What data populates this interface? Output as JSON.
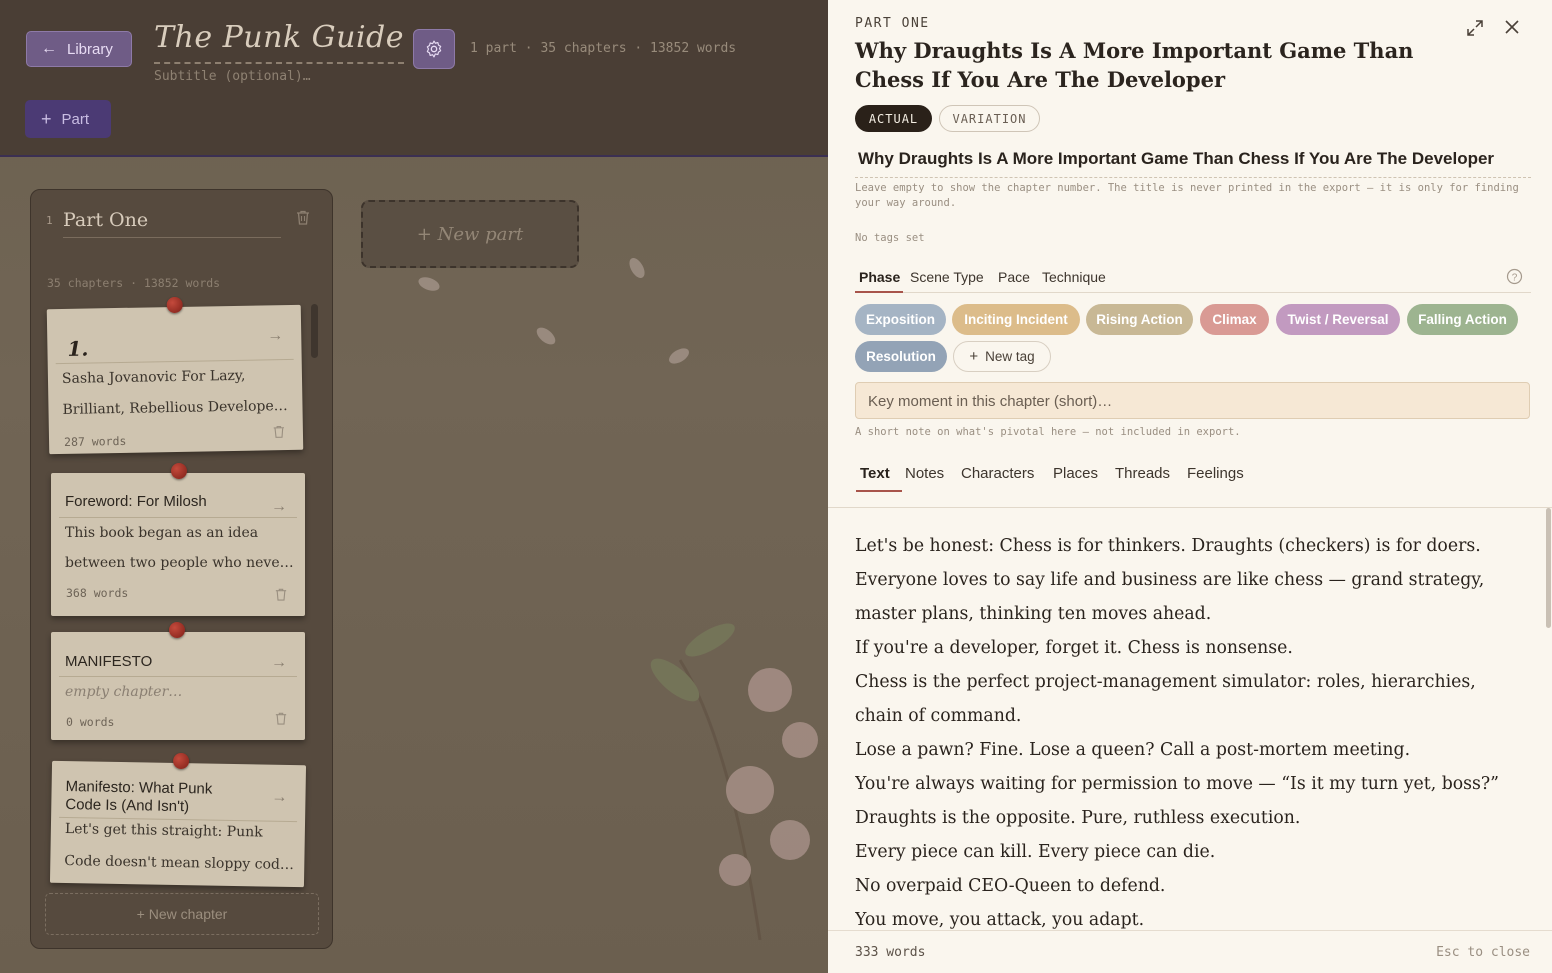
{
  "header": {
    "library_label": "Library",
    "book_title": "The Punk Guideto",
    "subtitle_placeholder": "Subtitle (optional)…",
    "stats": "1 part · 35 chapters · 13852 words",
    "add_part_label": "Part"
  },
  "board": {
    "part": {
      "number": "1",
      "name": "Part One",
      "stats": "35 chapters · 13852 words"
    },
    "cards": [
      {
        "title": "1.",
        "line1": "Sasha Jovanovic For Lazy,",
        "line2": "Brilliant, Rebellious Develope…",
        "words": "287 words"
      },
      {
        "title": "Foreword: For Milosh",
        "line1": "This book began as an idea",
        "line2": "between two people who neve…",
        "words": "368 words"
      },
      {
        "title": "MANIFESTO",
        "line1": "empty chapter…",
        "words": "0 words"
      },
      {
        "title_line1": "Manifesto: What Punk",
        "title_line2": "Code Is (And Isn't)",
        "line1": "Let's get this straight: Punk",
        "line2": "Code doesn't mean sloppy cod…"
      }
    ],
    "new_chapter_label": "+ New chapter",
    "new_part_label": "+ New part"
  },
  "panel": {
    "kicker": "PART ONE",
    "title": "Why Draughts Is A More Important Game Than Chess If You Are The Developer",
    "mode_actual": "ACTUAL",
    "mode_variation": "VARIATION",
    "title_input_value": "Why Draughts Is A More Important Game Than Chess If You Are The Developer",
    "title_hint": "Leave empty to show the chapter number. The title is never printed in the export — it is only for finding your way around.",
    "tags_status": "No tags set",
    "tag_tabs": [
      "Phase",
      "Scene Type",
      "Pace",
      "Technique"
    ],
    "tags": [
      {
        "label": "Exposition",
        "color": "#a5b4c4"
      },
      {
        "label": "Inciting Incident",
        "color": "#dcbc8a"
      },
      {
        "label": "Rising Action",
        "color": "#c8b895"
      },
      {
        "label": "Climax",
        "color": "#d99a94"
      },
      {
        "label": "Twist / Reversal",
        "color": "#c29ac0"
      },
      {
        "label": "Falling Action",
        "color": "#9db490"
      },
      {
        "label": "Resolution",
        "color": "#93a3b6"
      }
    ],
    "new_tag_label": "New tag",
    "moment_placeholder": "Key moment in this chapter (short)…",
    "moment_hint": "A short note on what's pivotal here — not included in export.",
    "content_tabs": [
      "Text",
      "Notes",
      "Characters",
      "Places",
      "Threads",
      "Feelings"
    ],
    "paragraphs": [
      "Let's be honest: Chess is for thinkers. Draughts (checkers) is for doers.",
      "Everyone loves to say life and business are like chess — grand strategy,",
      "master plans, thinking ten moves ahead.",
      "If you're a developer, forget it. Chess is nonsense.",
      "Chess is the perfect project-management simulator: roles, hierarchies,",
      "chain of command.",
      "Lose a pawn? Fine. Lose a queen? Call a post-mortem meeting.",
      "You're always waiting for permission to move — “Is it my turn yet, boss?”",
      "Draughts is the opposite. Pure, ruthless execution.",
      "Every piece can kill. Every piece can die.",
      "No overpaid CEO-Queen to defend.",
      "You move, you attack, you adapt."
    ],
    "word_count": "333 words",
    "close_hint": "Esc to close"
  }
}
